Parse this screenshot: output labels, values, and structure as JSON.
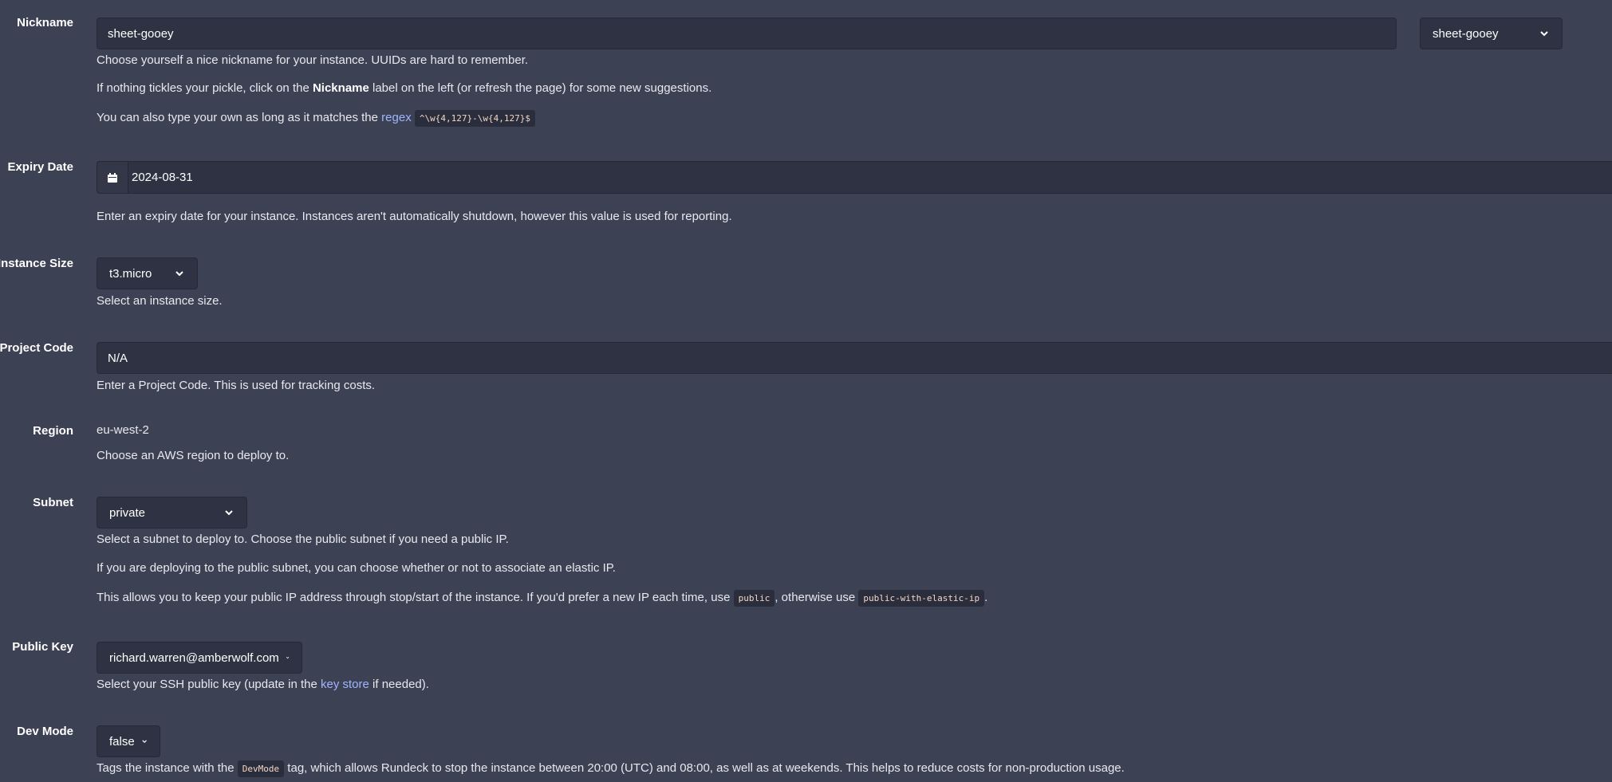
{
  "nickname": {
    "label": "Nickname",
    "value": "sheet-gooey",
    "select_value": "sheet-gooey",
    "help1": "Choose yourself a nice nickname for your instance. UUIDs are hard to remember.",
    "help2_prefix": "If nothing tickles your pickle, click on the ",
    "help2_bold": "Nickname",
    "help2_suffix": " label on the left (or refresh the page) for some new suggestions.",
    "help3_prefix": "You can also type your own as long as it matches the ",
    "help3_link": "regex",
    "help3_code": "^\\w{4,127}-\\w{4,127}$"
  },
  "expiry": {
    "label": "Expiry Date",
    "value": "2024-08-31",
    "icon": "calendar-icon",
    "help": "Enter an expiry date for your instance. Instances aren't automatically shutdown, however this value is used for reporting."
  },
  "instance_size": {
    "label": "Instance Size",
    "value": "t3.micro",
    "help": "Select an instance size."
  },
  "project_code": {
    "label": "Project Code",
    "value": "N/A",
    "help": "Enter a Project Code. This is used for tracking costs."
  },
  "region": {
    "label": "Region",
    "value": "eu-west-2",
    "help": "Choose an AWS region to deploy to."
  },
  "subnet": {
    "label": "Subnet",
    "value": "private",
    "help1": "Select a subnet to deploy to. Choose the public subnet if you need a public IP.",
    "help2": "If you are deploying to the public subnet, you can choose whether or not to associate an elastic IP.",
    "help3_prefix": "This allows you to keep your public IP address through stop/start of the instance. If you'd prefer a new IP each time, use ",
    "help3_code1": "public",
    "help3_mid": ", otherwise use ",
    "help3_code2": "public-with-elastic-ip",
    "help3_suffix": "."
  },
  "public_key": {
    "label": "Public Key",
    "value": "richard.warren@amberwolf.com",
    "help_prefix": "Select your SSH public key (update in the ",
    "help_link": "key store",
    "help_suffix": " if needed)."
  },
  "dev_mode": {
    "label": "Dev Mode",
    "value": "false",
    "help_prefix": "Tags the instance with the ",
    "help_code": "DevMode",
    "help_suffix": " tag, which allows Rundeck to stop the instance between 20:00 (UTC) and 08:00, as well as at weekends. This helps to reduce costs for non-production usage."
  },
  "colors": {
    "background": "#3d4154",
    "input_bg": "#2f3242",
    "link": "#9fb6ff"
  }
}
